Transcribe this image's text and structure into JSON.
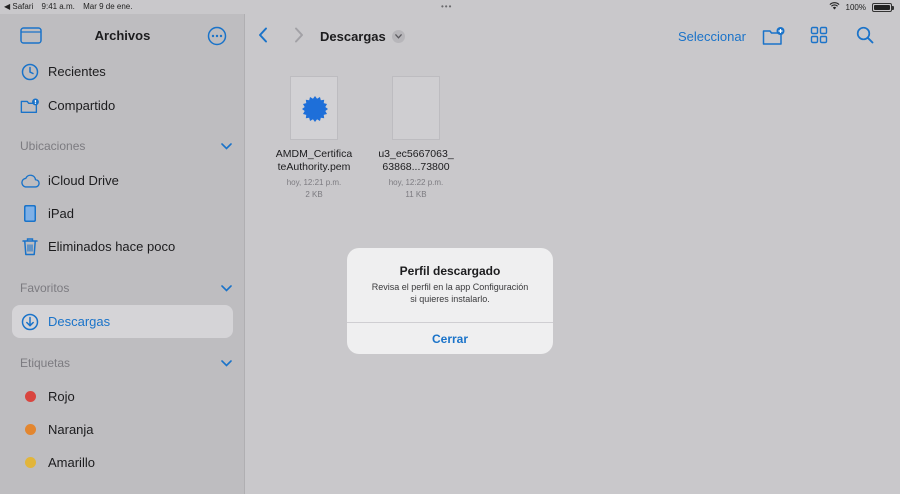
{
  "status_bar": {
    "back_app": "◀ Safari",
    "time": "9:41 a.m.",
    "date": "Mar 9 de ene.",
    "dots": "•••",
    "battery": "100%",
    "battery_level": 1.0
  },
  "sidebar": {
    "title": "Archivos",
    "items_top": [
      {
        "label": "Recientes",
        "icon": "clock-icon"
      },
      {
        "label": "Compartido",
        "icon": "shared-folder-icon"
      }
    ],
    "sections": {
      "locations": {
        "label": "Ubicaciones",
        "items": [
          {
            "label": "iCloud Drive",
            "icon": "cloud-icon"
          },
          {
            "label": "iPad",
            "icon": "ipad-icon"
          },
          {
            "label": "Eliminados hace poco",
            "icon": "trash-icon"
          }
        ]
      },
      "favorites": {
        "label": "Favoritos",
        "items": [
          {
            "label": "Descargas",
            "icon": "download-icon",
            "selected": true
          }
        ]
      },
      "tags": {
        "label": "Etiquetas",
        "items": [
          {
            "label": "Rojo",
            "color": "#d9453f"
          },
          {
            "label": "Naranja",
            "color": "#e3862f"
          },
          {
            "label": "Amarillo",
            "color": "#e2b53a"
          }
        ]
      }
    }
  },
  "toolbar": {
    "folder_title": "Descargas",
    "select_label": "Seleccionar"
  },
  "files": [
    {
      "name_line1": "AMDM_Certifica",
      "name_line2": "teAuthority.pem",
      "date": "hoy, 12:21 p.m.",
      "size": "2 KB",
      "icon": "certificate-badge-icon"
    },
    {
      "name_line1": "u3_ec5667063_",
      "name_line2": "63868...73800",
      "date": "hoy, 12:22 p.m.",
      "size": "11 KB",
      "icon": "blank-document-icon"
    }
  ],
  "alert": {
    "title": "Perfil descargado",
    "message_line1": "Revisa el perfil en la app Configuración",
    "message_line2": "si quieres instalarlo.",
    "button": "Cerrar"
  },
  "colors": {
    "accent": "#1a73c9",
    "cert_badge": "#1e6fd9"
  }
}
